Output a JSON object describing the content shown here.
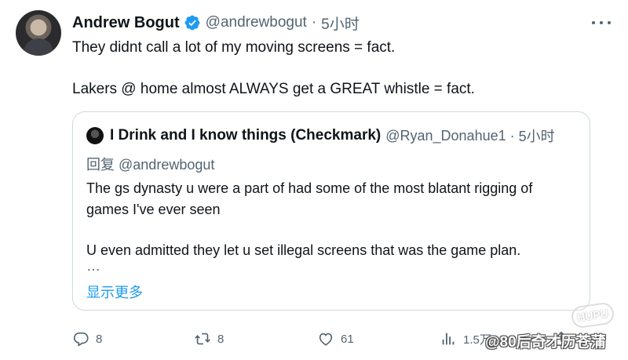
{
  "tweet": {
    "author": {
      "display_name": "Andrew Bogut",
      "handle": "@andrewbogut",
      "time": "5小时",
      "separator": "·"
    },
    "text_lines": [
      "They didnt call a lot of my moving screens = fact.",
      "Lakers @ home almost ALWAYS get a GREAT whistle = fact."
    ],
    "quote": {
      "display_name": "I Drink and I know things (Checkmark)",
      "handle": "@Ryan_Donahue1",
      "time": "5小时",
      "separator": "·",
      "reply_prefix": "回复",
      "reply_to": "@andrewbogut",
      "text_lines": [
        "The gs dynasty u were a part of had some of the most blatant rigging of",
        "games I've ever seen",
        "U even admitted they let u set illegal screens that was the game plan."
      ],
      "ellipsis": "…",
      "show_more": "显示更多"
    },
    "actions": {
      "reply_count": "8",
      "retweet_count": "8",
      "like_count": "61",
      "views_count": "1.5万"
    }
  },
  "watermark": {
    "text": "@80后奇才历苍蒲",
    "logo_text": "HUPU"
  },
  "colors": {
    "text_primary": "#0f1419",
    "text_secondary": "#536471",
    "accent": "#1d9bf0",
    "border": "#cfd9de"
  },
  "icons": [
    "verified-badge-icon",
    "more-options-icon",
    "reply-icon",
    "retweet-icon",
    "like-icon",
    "views-icon",
    "share-icon"
  ]
}
